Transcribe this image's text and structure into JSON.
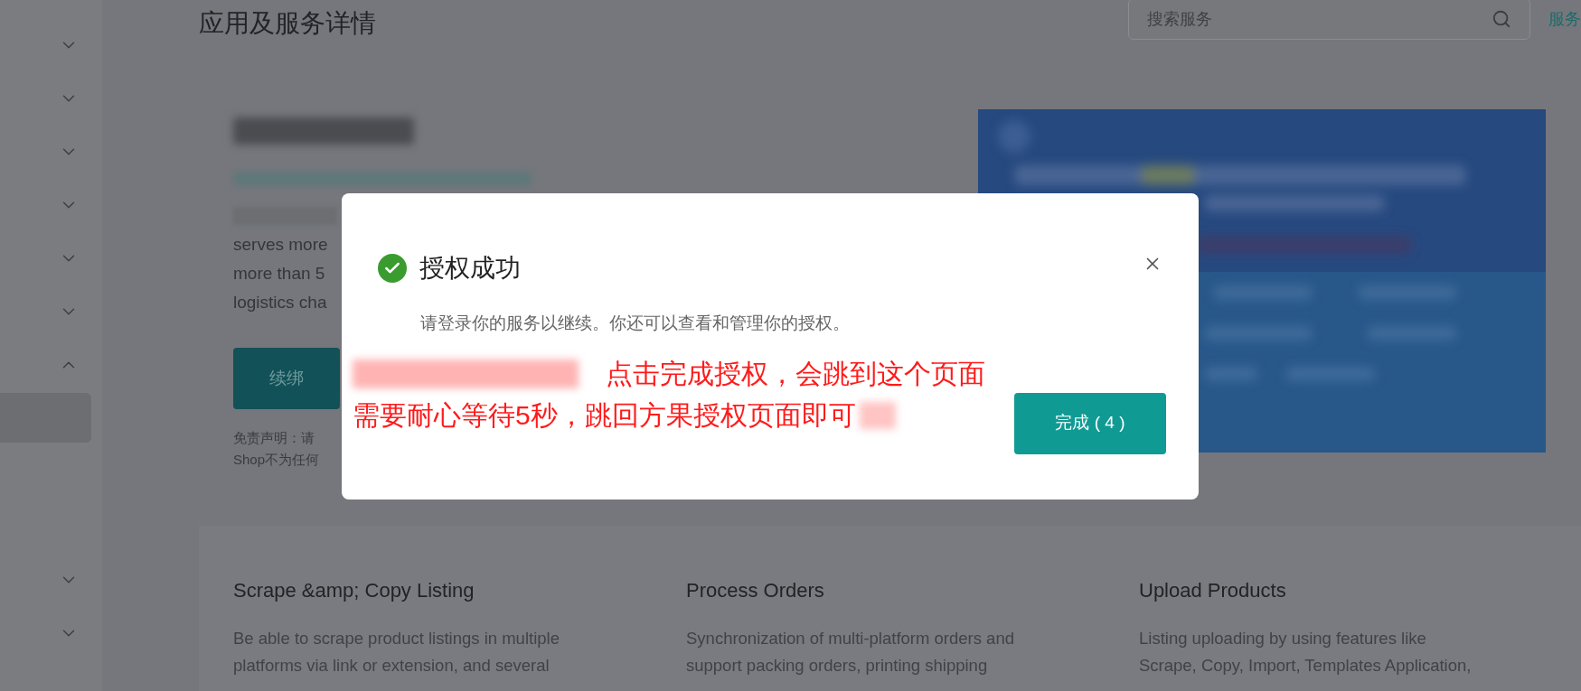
{
  "page": {
    "title": "应用及服务详情",
    "search": {
      "placeholder": "搜索服务"
    },
    "top_link": "服务"
  },
  "sidebar": {
    "items": [
      {
        "kind": "group",
        "expanded": false
      },
      {
        "kind": "group",
        "expanded": false
      },
      {
        "kind": "group",
        "expanded": false
      },
      {
        "kind": "group",
        "expanded": false
      },
      {
        "kind": "group",
        "expanded": false
      },
      {
        "kind": "group",
        "expanded": false
      },
      {
        "kind": "group",
        "expanded": true
      },
      {
        "kind": "entry",
        "selected": true
      },
      {
        "kind": "group",
        "expanded": false
      },
      {
        "kind": "group",
        "expanded": false
      }
    ]
  },
  "app": {
    "description_lines": [
      "serves more",
      "more than 5",
      "logistics cha"
    ],
    "button": "续绑",
    "disclaimer_lines": [
      "免责声明：请",
      "Shop不为任何"
    ]
  },
  "features": [
    {
      "title": "Scrape &amp; Copy Listing",
      "description_lines": [
        "Be able to scrape product listings in multiple",
        "platforms via link or extension, and several"
      ]
    },
    {
      "title": "Process Orders",
      "description_lines": [
        "Synchronization of multi-platform orders and",
        "support packing orders, printing shipping"
      ]
    },
    {
      "title": "Upload Products",
      "description_lines": [
        "Listing uploading by using features like",
        "Scrape, Copy, Import, Templates Application,"
      ]
    }
  ],
  "dialog": {
    "kind": "success",
    "title": "授权成功",
    "message": "请登录你的服务以继续。你还可以查看和管理你的授权。",
    "button": "完成 ( 4 )"
  },
  "annotation": {
    "lines": [
      "点击完成授权，会跳到这个页面",
      "需要耐心等待5秒，跳回方果授权页面即可"
    ]
  }
}
